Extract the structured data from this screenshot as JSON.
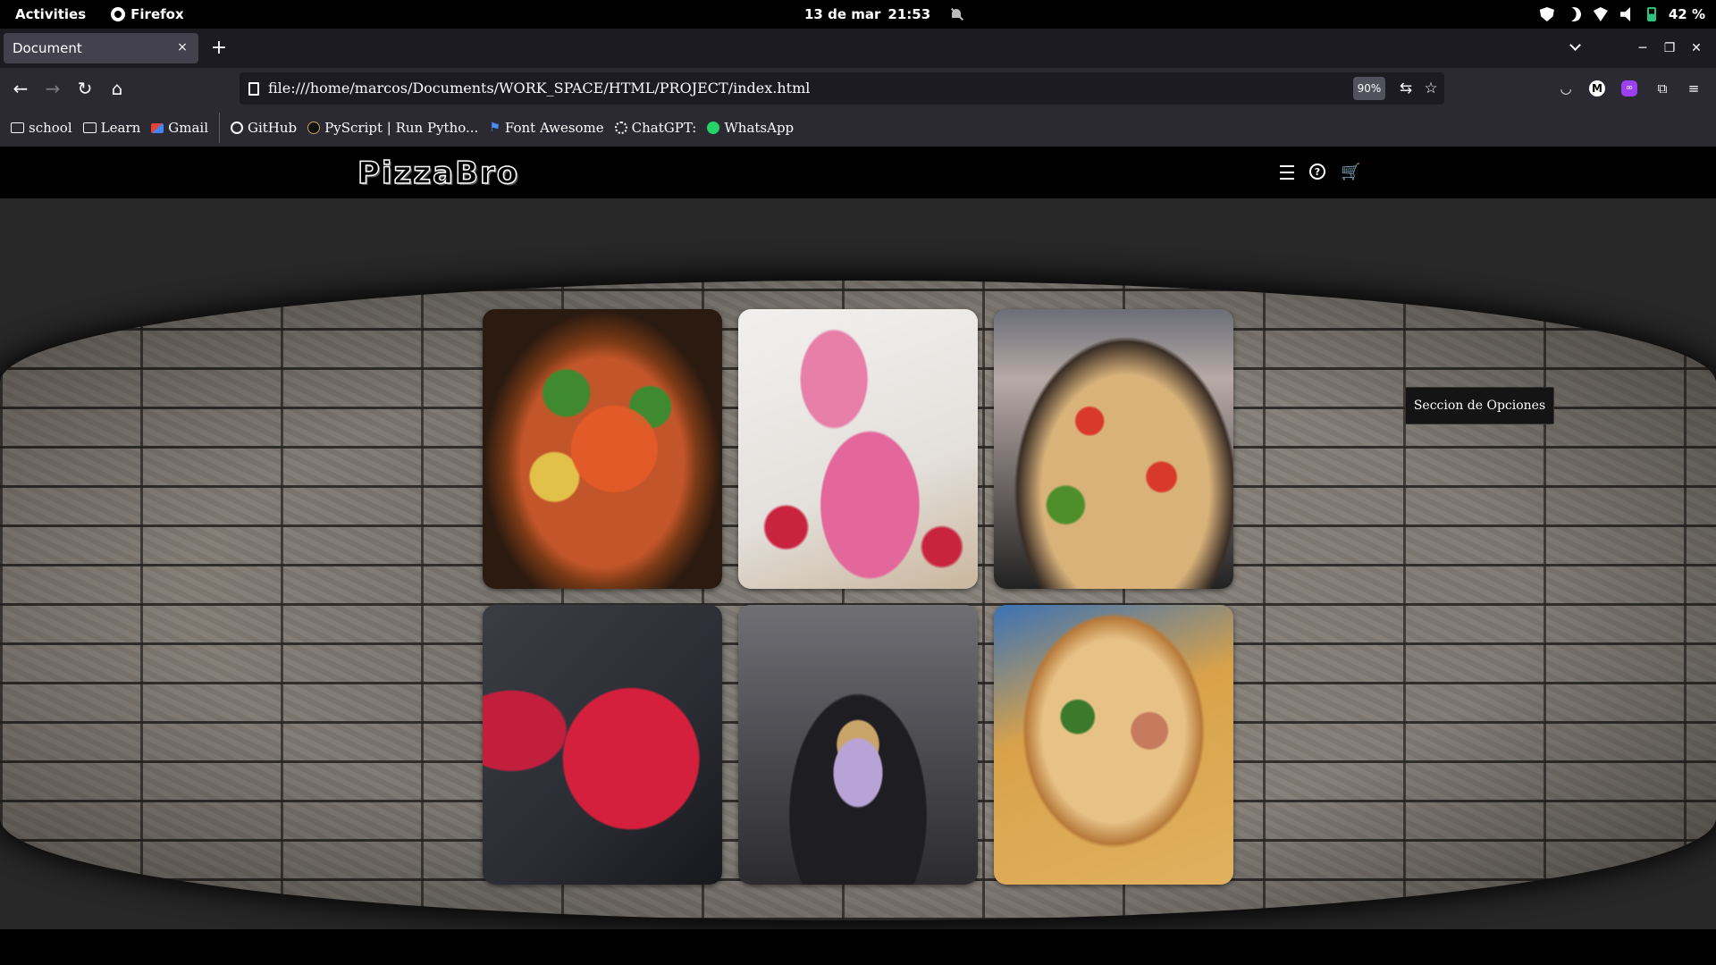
{
  "gnome": {
    "activities": "Activities",
    "app_name": "Firefox",
    "date": "13 de mar",
    "time": "21:53",
    "battery": "42 %"
  },
  "browser": {
    "tab_title": "Document",
    "tab_close": "×",
    "new_tab": "+",
    "url": "file:///home/marcos/Documents/WORK_SPACE/HTML/PROJECT/index.html",
    "zoom": "90%",
    "account_initial": "M"
  },
  "bookmarks": [
    {
      "label": "school",
      "icon": "folder-icon"
    },
    {
      "label": "Learn",
      "icon": "folder-icon"
    },
    {
      "label": "Gmail",
      "icon": "gmail-icon"
    },
    {
      "label": "GitHub",
      "icon": "github-icon"
    },
    {
      "label": "PyScript | Run Pytho...",
      "icon": "pyscript-icon"
    },
    {
      "label": "Font Awesome",
      "icon": "flag-icon"
    },
    {
      "label": "ChatGPT:",
      "icon": "chatgpt-icon"
    },
    {
      "label": "WhatsApp",
      "icon": "whatsapp-icon"
    }
  ],
  "site": {
    "logo": "PizzaBro",
    "options_button": "Seccion de Opciones",
    "gallery": [
      {
        "name": "pizza-pepperoni-basil",
        "kind": "pizza"
      },
      {
        "name": "raspberry-smoothie-glasses",
        "kind": "drink"
      },
      {
        "name": "pizza-tomato-herbs",
        "kind": "pizza"
      },
      {
        "name": "red-smoothie-jar",
        "kind": "drink"
      },
      {
        "name": "berry-parfait-glass",
        "kind": "dessert"
      },
      {
        "name": "pizza-prosciutto-arugula",
        "kind": "pizza"
      }
    ]
  },
  "colors": {
    "page_background": "#282728",
    "header_background": "#000000",
    "firefox_chrome": "#2b2a33",
    "battery_green": "#2ec27e"
  }
}
